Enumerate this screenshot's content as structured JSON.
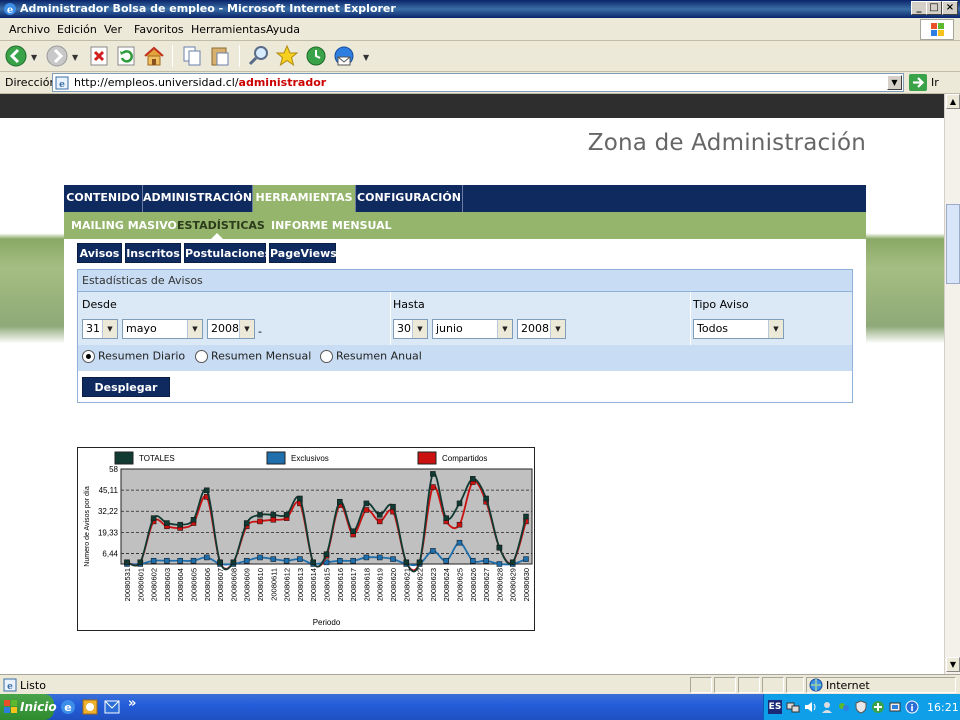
{
  "window": {
    "title": "Administrador Bolsa de empleo - Microsoft Internet Explorer",
    "min_glyph": "_",
    "max_glyph": "□",
    "close_glyph": "×"
  },
  "menu": [
    "Archivo",
    "Edición",
    "Ver",
    "Favoritos",
    "Herramientas",
    "Ayuda"
  ],
  "toolbar": {
    "icons": [
      "back-icon",
      "forward-icon",
      "stop-icon",
      "refresh-icon",
      "home-icon",
      "copy-icon",
      "paste-icon",
      "search-icon",
      "favorites-icon",
      "history-icon",
      "mail-icon"
    ]
  },
  "address": {
    "label": "Dirección",
    "url_prefix": "http://empleos.universidad.cl/",
    "url_bold": "administrador",
    "go_label": "Ir"
  },
  "page": {
    "title": "Zona de Administración",
    "main_nav": [
      {
        "label": "CONTENIDO",
        "active": false
      },
      {
        "label": "ADMINISTRACIÓN",
        "active": false
      },
      {
        "label": "HERRAMIENTAS",
        "active": true
      },
      {
        "label": "CONFIGURACIÓN",
        "active": false
      }
    ],
    "sub_nav": [
      {
        "label": "MAILING MASIVO",
        "active": false
      },
      {
        "label": "ESTADÍSTICAS",
        "active": true
      },
      {
        "label": "INFORME MENSUAL",
        "active": false
      }
    ],
    "pills": [
      "Avisos",
      "Inscritos",
      "Postulaciones",
      "PageViews"
    ],
    "panel": {
      "heading": "Estadísticas de Avisos",
      "desde_label": "Desde",
      "hasta_label": "Hasta",
      "tipo_label": "Tipo Aviso",
      "desde": {
        "day": "31",
        "month": "mayo",
        "year": "2008"
      },
      "hasta": {
        "day": "30",
        "month": "junio",
        "year": "2008"
      },
      "tipo": "Todos",
      "dash": "-",
      "radios": [
        {
          "label": "Resumen Diario",
          "checked": true
        },
        {
          "label": "Resumen Mensual",
          "checked": false
        },
        {
          "label": "Resumen Anual",
          "checked": false
        }
      ],
      "submit_label": "Desplegar"
    }
  },
  "chart_data": {
    "type": "line",
    "xlabel": "Periodo",
    "ylabel": "Numero de Avisos por día",
    "ylim": [
      0,
      58
    ],
    "yticks": [
      "58",
      "45,11",
      "32,22",
      "19,33",
      "6,44"
    ],
    "ytick_values": [
      58,
      45.11,
      32.22,
      19.33,
      6.44
    ],
    "grid": true,
    "legend_position": "top",
    "categories": [
      "20080531",
      "20080601",
      "20080602",
      "20080603",
      "20080604",
      "20080605",
      "20080606",
      "20080607",
      "20080608",
      "20080609",
      "20080610",
      "20080611",
      "20080612",
      "20080613",
      "20080614",
      "20080615",
      "20080616",
      "20080617",
      "20080618",
      "20080619",
      "20080620",
      "20080621",
      "20080622",
      "20080623",
      "20080624",
      "20080625",
      "20080626",
      "20080627",
      "20080628",
      "20080629",
      "20080630"
    ],
    "series": [
      {
        "name": "TOTALES",
        "color": "#113a33",
        "values": [
          1,
          1,
          28,
          25,
          24,
          27,
          45,
          1,
          1,
          25,
          30,
          30,
          30,
          40,
          1,
          6,
          38,
          20,
          37,
          30,
          35,
          1,
          1,
          55,
          28,
          37,
          52,
          40,
          10,
          1,
          29
        ]
      },
      {
        "name": "Exclusivos",
        "color": "#1f6fad",
        "values": [
          0,
          0,
          2,
          2,
          2,
          2,
          4,
          0,
          0,
          2,
          4,
          3,
          2,
          3,
          0,
          1,
          2,
          2,
          4,
          4,
          3,
          0,
          0,
          8,
          2,
          13,
          2,
          2,
          0,
          0,
          3
        ]
      },
      {
        "name": "Compartidos",
        "color": "#cc1111",
        "values": [
          1,
          1,
          26,
          23,
          22,
          25,
          41,
          1,
          1,
          23,
          26,
          27,
          28,
          37,
          1,
          5,
          36,
          18,
          33,
          26,
          32,
          1,
          1,
          47,
          26,
          24,
          50,
          38,
          10,
          1,
          26
        ]
      }
    ]
  },
  "status": {
    "text": "Listo",
    "zone": "Internet"
  },
  "taskbar": {
    "start_label": "Inicio",
    "more": "»",
    "lang": "ES",
    "clock": "16:21"
  }
}
